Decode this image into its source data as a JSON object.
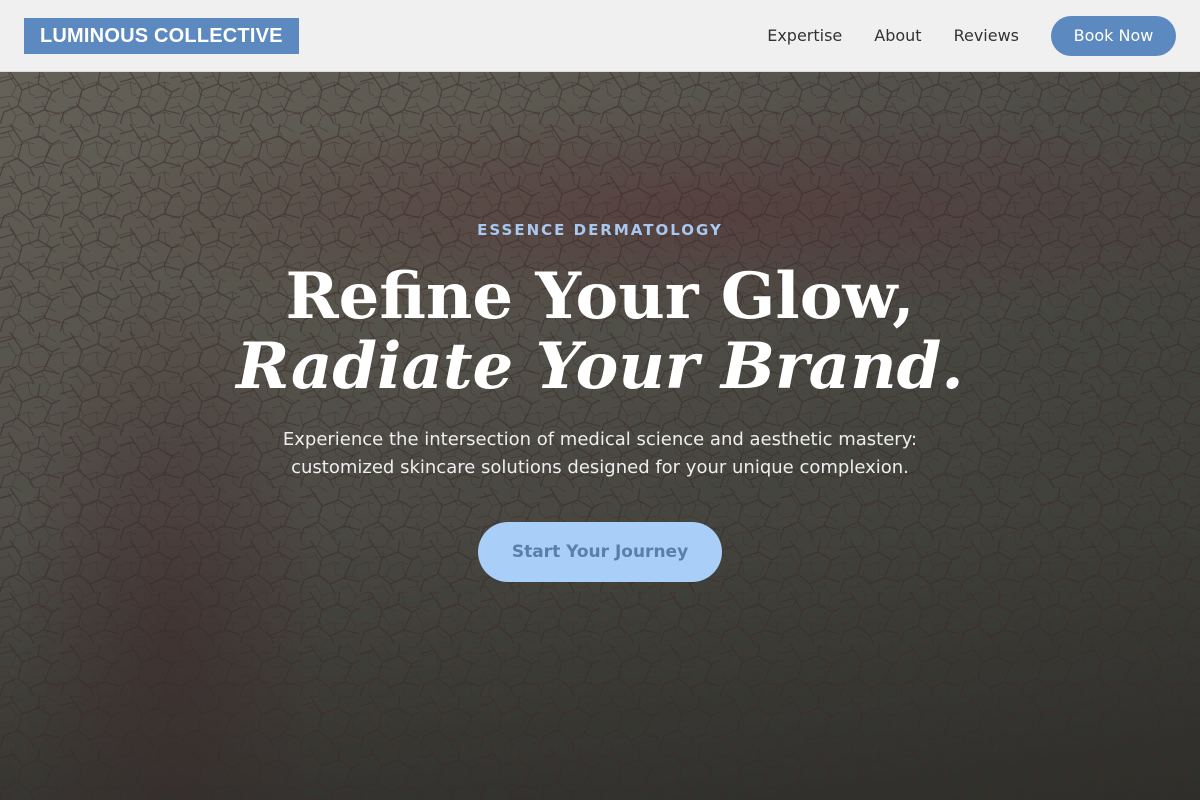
{
  "brand": {
    "name": "LUMINOUS COLLECTIVE"
  },
  "nav": {
    "links": [
      "Expertise",
      "About",
      "Reviews"
    ],
    "cta_label": "Book Now"
  },
  "hero": {
    "eyebrow": "ESSENCE DERMATOLOGY",
    "headline_line1": "Refine Your Glow,",
    "headline_line2": "Radiate Your Brand.",
    "subtitle_line1": "Experience the intersection of medical science and aesthetic mastery:",
    "subtitle_line2": "customized skincare solutions designed for your unique complexion.",
    "cta_label": "Start Your Journey"
  },
  "colors": {
    "accent": "#5b89c0",
    "eyebrow": "#a9c8f0",
    "cta_bg": "#a9cef7",
    "nav_bg": "#f0f0f0"
  }
}
